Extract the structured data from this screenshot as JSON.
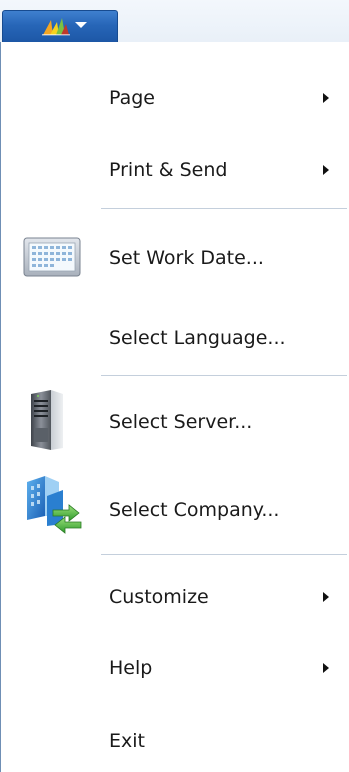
{
  "app_button": {
    "logo_icon": "dynamics-nav-logo-icon",
    "dropdown_icon": "chevron-down-icon"
  },
  "menu": {
    "items": [
      {
        "label": "Page",
        "submenu": true
      },
      {
        "label": "Print & Send",
        "submenu": true
      },
      {
        "label": "Set Work Date...",
        "icon": "calendar-icon"
      },
      {
        "label": "Select Language..."
      },
      {
        "label": "Select Server...",
        "icon": "server-icon"
      },
      {
        "label": "Select Company...",
        "icon": "company-switch-icon"
      },
      {
        "label": "Customize",
        "submenu": true
      },
      {
        "label": "Help",
        "submenu": true
      },
      {
        "label": "Exit"
      }
    ]
  },
  "colors": {
    "app_button_blue": "#2766b8",
    "separator": "#c4cfdc",
    "menu_border": "#6f8fb5"
  }
}
